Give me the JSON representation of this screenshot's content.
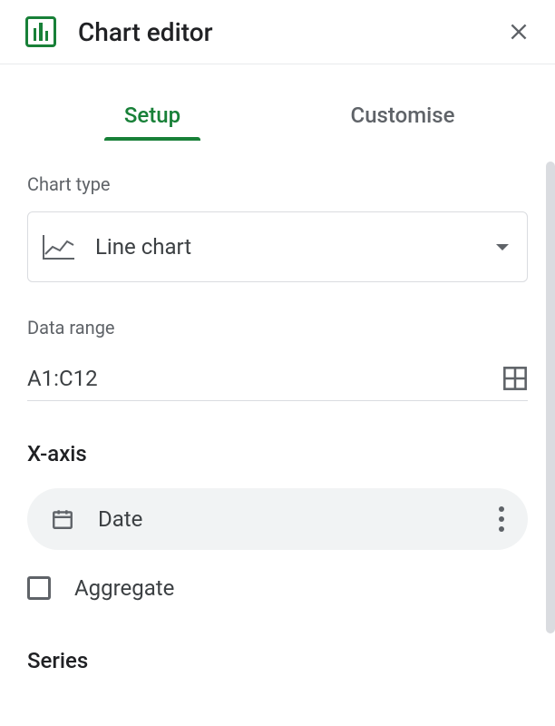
{
  "header": {
    "title": "Chart editor"
  },
  "tabs": {
    "setup": "Setup",
    "customise": "Customise"
  },
  "chartType": {
    "label": "Chart type",
    "value": "Line chart"
  },
  "dataRange": {
    "label": "Data range",
    "value": "A1:C12"
  },
  "xaxis": {
    "heading": "X-axis",
    "column": "Date",
    "aggregateLabel": "Aggregate"
  },
  "series": {
    "heading": "Series"
  }
}
